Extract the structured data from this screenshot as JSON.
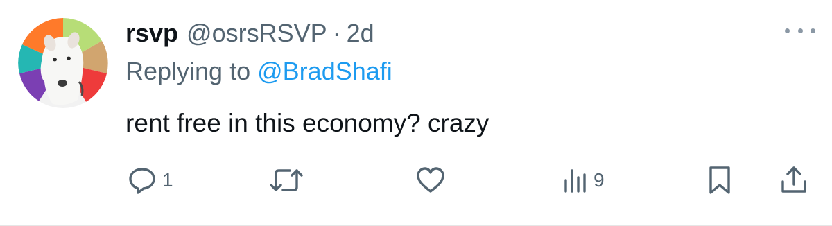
{
  "tweet": {
    "display_name": "rsvp",
    "handle": "@osrsRSVP",
    "separator": "·",
    "time": "2d",
    "replying_prefix": "Replying to",
    "replying_to": "@BradShafi",
    "text": "rent free in this economy? crazy"
  },
  "actions": {
    "reply_count": "1",
    "retweet_count": "",
    "like_count": "",
    "views_count": "9"
  },
  "icons": {
    "more": "more-horizontal-icon",
    "reply": "reply-icon",
    "retweet": "retweet-icon",
    "like": "heart-icon",
    "views": "views-icon",
    "bookmark": "bookmark-icon",
    "share": "share-icon"
  },
  "colors": {
    "text_primary": "#0f1419",
    "text_secondary": "#536471",
    "accent": "#1d9bf0",
    "icon": "#536471"
  }
}
